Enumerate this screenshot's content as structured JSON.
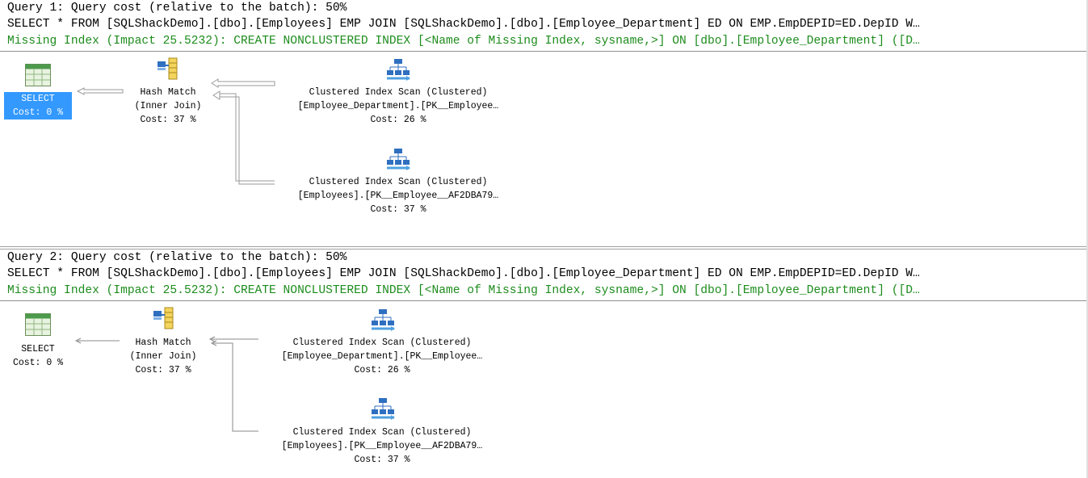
{
  "plans": [
    {
      "query_cost": "Query 1: Query cost (relative to the batch): 50%",
      "sql": "SELECT * FROM [SQLShackDemo].[dbo].[Employees] EMP JOIN [SQLShackDemo].[dbo].[Employee_Department] ED ON EMP.EmpDEPID=ED.DepID W…",
      "missing_index": "Missing Index (Impact 25.5232): CREATE NONCLUSTERED INDEX [<Name of Missing Index, sysname,>] ON [dbo].[Employee_Department] ([D…",
      "select": {
        "label": "SELECT",
        "cost": "Cost: 0 %",
        "selected": true
      },
      "hash": {
        "title": "Hash Match",
        "sub": "(Inner Join)",
        "cost": "Cost: 37 %"
      },
      "scan1": {
        "title": "Clustered Index Scan (Clustered)",
        "obj": "[Employee_Department].[PK__Employee…",
        "cost": "Cost: 26 %"
      },
      "scan2": {
        "title": "Clustered Index Scan (Clustered)",
        "obj": "[Employees].[PK__Employee__AF2DBA79…",
        "cost": "Cost: 37 %"
      }
    },
    {
      "query_cost": "Query 2: Query cost (relative to the batch): 50%",
      "sql": "SELECT * FROM [SQLShackDemo].[dbo].[Employees] EMP JOIN [SQLShackDemo].[dbo].[Employee_Department] ED ON EMP.EmpDEPID=ED.DepID W…",
      "missing_index": "Missing Index (Impact 25.5232): CREATE NONCLUSTERED INDEX [<Name of Missing Index, sysname,>] ON [dbo].[Employee_Department] ([D…",
      "select": {
        "label": "SELECT",
        "cost": "Cost: 0 %",
        "selected": false
      },
      "hash": {
        "title": "Hash Match",
        "sub": "(Inner Join)",
        "cost": "Cost: 37 %"
      },
      "scan1": {
        "title": "Clustered Index Scan (Clustered)",
        "obj": "[Employee_Department].[PK__Employee…",
        "cost": "Cost: 26 %"
      },
      "scan2": {
        "title": "Clustered Index Scan (Clustered)",
        "obj": "[Employees].[PK__Employee__AF2DBA79…",
        "cost": "Cost: 37 %"
      }
    }
  ],
  "icons": {
    "select": "select-table-icon",
    "hash": "hash-match-icon",
    "scan": "clustered-index-scan-icon"
  },
  "colors": {
    "missing_index_text": "#1d8c1d",
    "selection": "#3399ff"
  }
}
